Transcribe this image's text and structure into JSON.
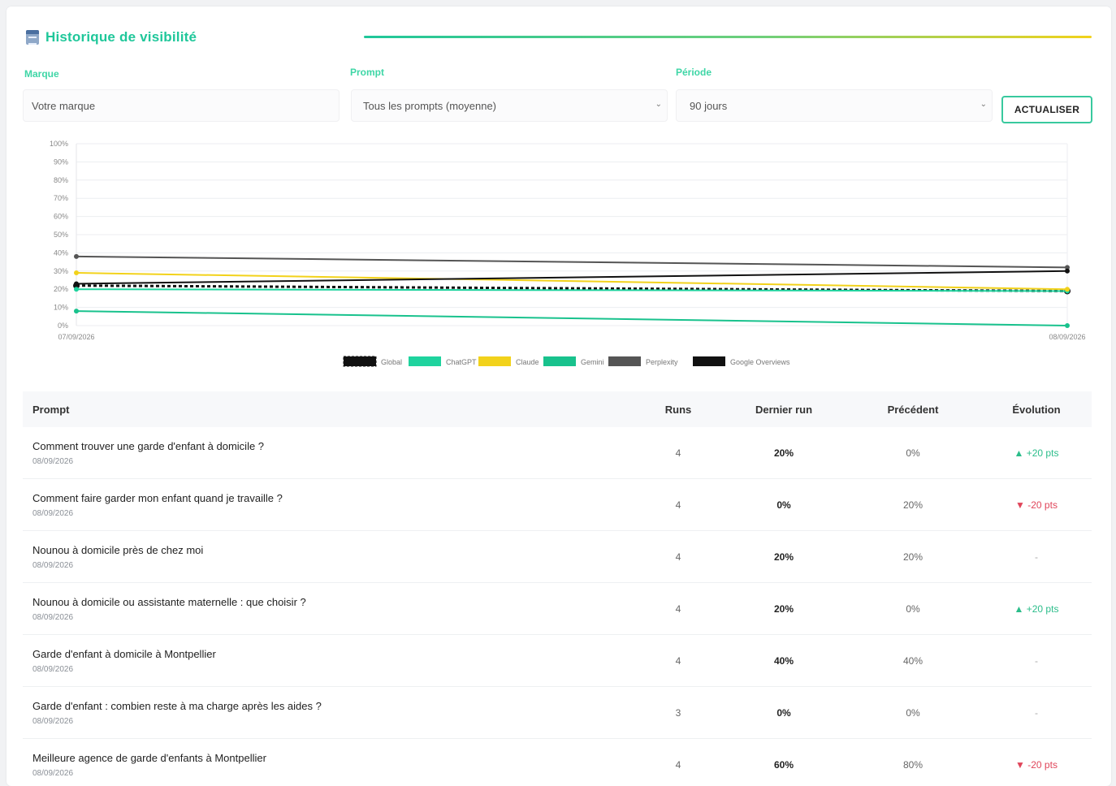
{
  "header": {
    "title": "Historique de visibilité",
    "icon": "calendar-icon"
  },
  "filters": {
    "brand": {
      "label": "Marque",
      "value": "Votre marque"
    },
    "prompt": {
      "label": "Prompt",
      "value": "Tous les prompts (moyenne)"
    },
    "period": {
      "label": "Période",
      "value": "90 jours"
    },
    "refresh_label": "ACTUALISER"
  },
  "colors": {
    "accent": "#1fc79a",
    "accent_yellow": "#f2d21b",
    "up": "#2bbd8a",
    "down": "#e0455a"
  },
  "chart_data": {
    "type": "line",
    "x": [
      "07/09/2026",
      "08/09/2026"
    ],
    "ylim": [
      0,
      100
    ],
    "yticks": [
      "0%",
      "10%",
      "20%",
      "30%",
      "40%",
      "50%",
      "60%",
      "70%",
      "80%",
      "90%",
      "100%"
    ],
    "grid": true,
    "legend": "bottom",
    "series": [
      {
        "name": "Global",
        "values": [
          22,
          19
        ],
        "color": "#111111",
        "dashed": true
      },
      {
        "name": "ChatGPT",
        "values": [
          20,
          19
        ],
        "color": "#1fd39e"
      },
      {
        "name": "Claude",
        "values": [
          29,
          20
        ],
        "color": "#f2d21b"
      },
      {
        "name": "Gemini",
        "values": [
          8,
          0
        ],
        "color": "#19c28d"
      },
      {
        "name": "Perplexity",
        "values": [
          38,
          32
        ],
        "color": "#555555"
      },
      {
        "name": "Google Overviews",
        "values": [
          23,
          30
        ],
        "color": "#111111"
      }
    ]
  },
  "table": {
    "headers": {
      "prompt": "Prompt",
      "runs": "Runs",
      "last": "Dernier run",
      "prev": "Précédent",
      "evo": "Évolution"
    },
    "rows": [
      {
        "prompt": "Comment trouver une garde d'enfant à domicile ?",
        "date": "08/09/2026",
        "runs": "4",
        "last": "20%",
        "prev": "0%",
        "evo": "▲ +20 pts",
        "dir": "up"
      },
      {
        "prompt": "Comment faire garder mon enfant quand je travaille ?",
        "date": "08/09/2026",
        "runs": "4",
        "last": "0%",
        "prev": "20%",
        "evo": "▼ -20 pts",
        "dir": "down"
      },
      {
        "prompt": "Nounou à domicile près de chez moi",
        "date": "08/09/2026",
        "runs": "4",
        "last": "20%",
        "prev": "20%",
        "evo": "-",
        "dir": "flat"
      },
      {
        "prompt": "Nounou à domicile ou assistante maternelle : que choisir ?",
        "date": "08/09/2026",
        "runs": "4",
        "last": "20%",
        "prev": "0%",
        "evo": "▲ +20 pts",
        "dir": "up"
      },
      {
        "prompt": "Garde d'enfant à domicile à Montpellier",
        "date": "08/09/2026",
        "runs": "4",
        "last": "40%",
        "prev": "40%",
        "evo": "-",
        "dir": "flat"
      },
      {
        "prompt": "Garde d'enfant : combien reste à ma charge après les aides ?",
        "date": "08/09/2026",
        "runs": "3",
        "last": "0%",
        "prev": "0%",
        "evo": "-",
        "dir": "flat"
      },
      {
        "prompt": "Meilleure agence de garde d'enfants à Montpellier",
        "date": "08/09/2026",
        "runs": "4",
        "last": "60%",
        "prev": "80%",
        "evo": "▼ -20 pts",
        "dir": "down"
      }
    ]
  }
}
